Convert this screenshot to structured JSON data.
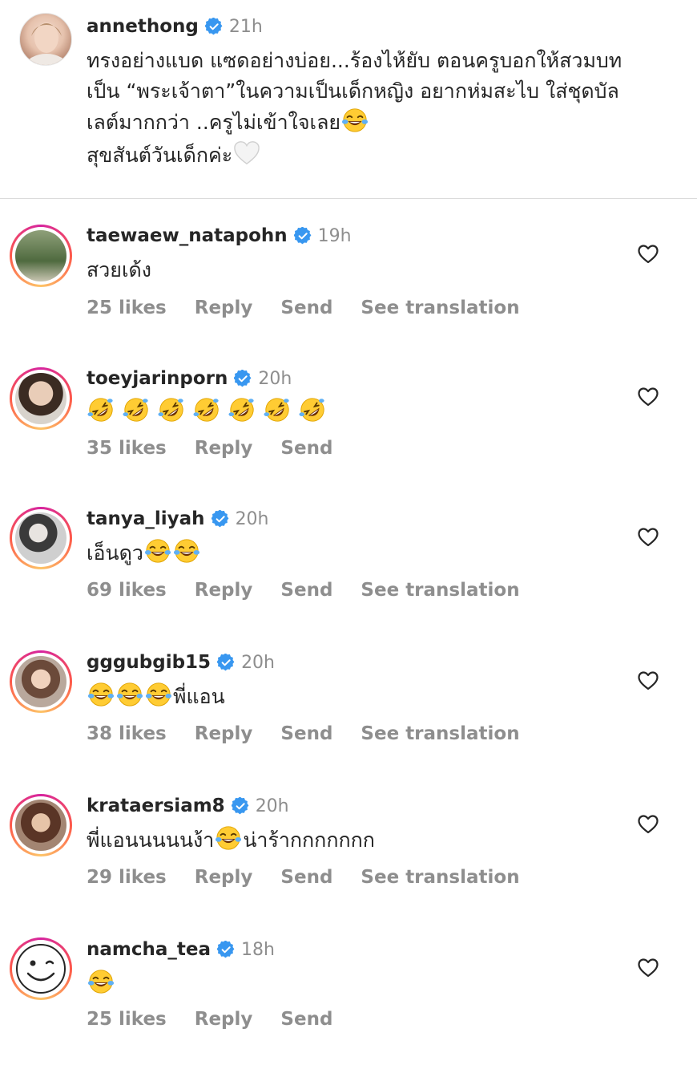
{
  "post": {
    "username": "annethong",
    "time": "21h",
    "caption": [
      "ทรงอย่างแบด แซดอย่างบ่อย...ร้องไห้ยับ ตอนครูบอกให้สวมบท",
      "เป็น “พระเจ้าตา”ในความเป็นเด็กหญิง อยากห่มสะไบ ใส่ชุดบัล",
      "เลต์มากกว่า ..ครูไม่เข้าใจเลย",
      "สุขสันต์วันเด็กค่ะ"
    ]
  },
  "comments": [
    {
      "username": "taewaew_natapohn",
      "time": "19h",
      "text": "สวยเด้ง",
      "likes": "25 likes",
      "reply": "Reply",
      "send": "Send",
      "translate": "See translation"
    },
    {
      "username": "toeyjarinporn",
      "time": "20h",
      "text": "",
      "likes": "35 likes",
      "reply": "Reply",
      "send": "Send",
      "translate": ""
    },
    {
      "username": "tanya_liyah",
      "time": "20h",
      "text": "เอ็นดูว",
      "likes": "69 likes",
      "reply": "Reply",
      "send": "Send",
      "translate": "See translation"
    },
    {
      "username": "gggubgib15",
      "time": "20h",
      "text": "พี่แอน",
      "likes": "38 likes",
      "reply": "Reply",
      "send": "Send",
      "translate": "See translation"
    },
    {
      "username": "krataersiam8",
      "time": "20h",
      "text_a": "พี่แอนนนนนง้า",
      "text_b": "น่าร้ากกกกกกก",
      "likes": "29 likes",
      "reply": "Reply",
      "send": "Send",
      "translate": "See translation"
    },
    {
      "username": "namcha_tea",
      "time": "18h",
      "text": "",
      "likes": "25 likes",
      "reply": "Reply",
      "send": "Send",
      "translate": ""
    }
  ],
  "icons": {
    "verified": "verified-badge-icon",
    "heart": "heart-outline-icon",
    "joy": "face-with-tears-of-joy-emoji",
    "rofl": "rolling-on-the-floor-laughing-emoji",
    "white_heart": "white-heart-emoji"
  },
  "colors": {
    "verified": "#3897f0",
    "meta": "#8e8e8e",
    "text": "#262626"
  }
}
